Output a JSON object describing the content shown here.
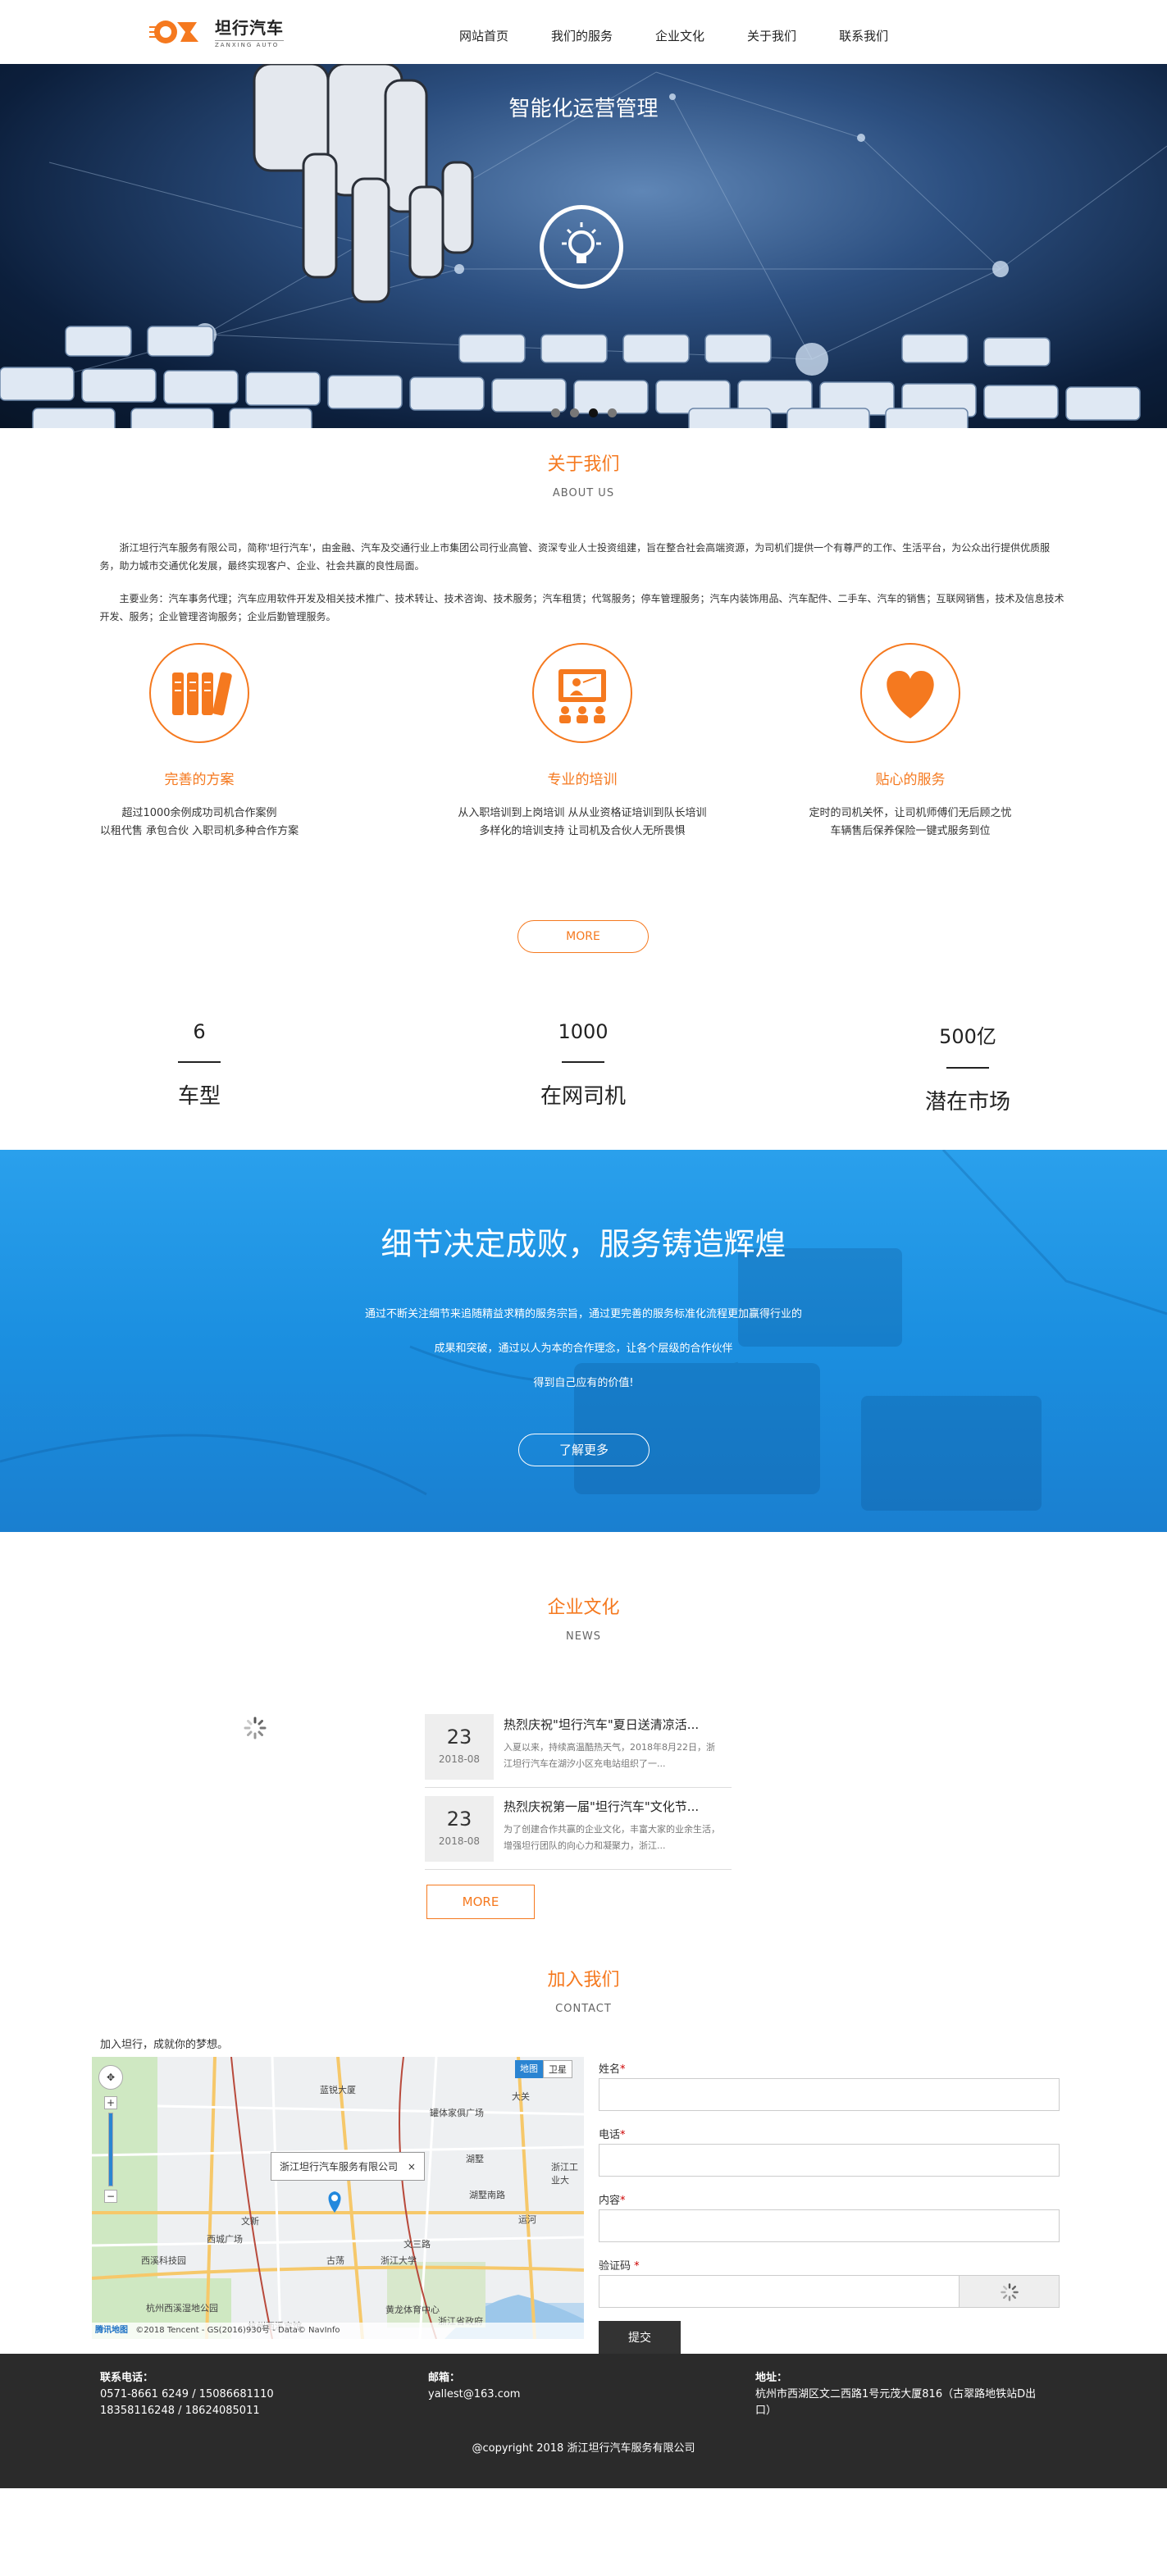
{
  "header": {
    "logo_cn": "坦行汽车",
    "logo_en": "ZANXING AUTO",
    "nav": [
      "网站首页",
      "我们的服务",
      "企业文化",
      "关于我们",
      "联系我们"
    ]
  },
  "hero": {
    "title": "智能化运营管理",
    "slide_count": 4,
    "active_slide": 3
  },
  "about": {
    "title": "关于我们",
    "subtitle": "ABOUT US",
    "para1": "浙江坦行汽车服务有限公司，简称'坦行汽车'，由金融、汽车及交通行业上市集团公司行业高管、资深专业人士投资组建，旨在整合社会高端资源，为司机们提供一个有尊严的工作、生活平台，为公众出行提供优质服务，助力城市交通优化发展，最终实现客户、企业、社会共赢的良性局面。",
    "para2": "主要业务：汽车事务代理；汽车应用软件开发及相关技术推广、技术转让、技术咨询、技术服务；汽车租赁；代驾服务；停车管理服务；汽车内装饰用品、汽车配件、二手车、汽车的销售；互联网销售，技术及信息技术开发、服务；企业管理咨询服务；企业后勤管理服务。",
    "features": [
      {
        "title": "完善的方案",
        "desc1": "超过1000余例成功司机合作案例",
        "desc2": "以租代售 承包合伙 入职司机多种合作方案",
        "icon": "books-icon"
      },
      {
        "title": "专业的培训",
        "desc1": "从入职培训到上岗培训 从从业资格证培训到队长培训",
        "desc2": "多样化的培训支持 让司机及合伙人无所畏惧",
        "icon": "teacher-icon"
      },
      {
        "title": "贴心的服务",
        "desc1": "定时的司机关怀，让司机师傅们无后顾之忧",
        "desc2": "车辆售后保养保险一键式服务到位",
        "icon": "heart-icon"
      }
    ],
    "more": "MORE"
  },
  "stats": [
    {
      "num": "6",
      "label": "车型"
    },
    {
      "num": "1000",
      "label": "在网司机"
    },
    {
      "num": "500亿",
      "label": "潜在市场"
    }
  ],
  "banner": {
    "title": "细节决定成败，服务铸造辉煌",
    "line1": "通过不断关注细节来追随精益求精的服务宗旨，通过更完善的服务标准化流程更加赢得行业的",
    "line2": "成果和突破，通过以人为本的合作理念，让各个层级的合作伙伴",
    "line3": "得到自己应有的价值!",
    "button": "了解更多"
  },
  "news": {
    "title": "企业文化",
    "subtitle": "NEWS",
    "items": [
      {
        "day": "23",
        "ym": "2018-08",
        "title": "热烈庆祝\"坦行汽车\"夏日送清凉活...",
        "summary": "入夏以来，持续高温酷热天气，2018年8月22日，浙江坦行汽车在湖汐小区充电站组织了一..."
      },
      {
        "day": "23",
        "ym": "2018-08",
        "title": "热烈庆祝第一届\"坦行汽车\"文化节...",
        "summary": "为了创建合作共赢的企业文化，丰富大家的业余生活，增强坦行团队的向心力和凝聚力，浙江..."
      }
    ],
    "more": "MORE"
  },
  "contact": {
    "title": "加入我们",
    "subtitle": "CONTACT",
    "intro": "加入坦行，成就你的梦想。",
    "map": {
      "toggle_map": "地图",
      "toggle_sat": "卫星",
      "popup": "浙江坦行汽车服务有限公司",
      "labels": [
        "蓝锐大厦",
        "大关",
        "罐体家俱广场",
        "湖墅",
        "浙江工业大",
        "湖墅南路",
        "文新",
        "西城广场",
        "古荡",
        "文三路",
        "杭州西溪湿地公园",
        "浙江大学",
        "杭州西溪宾馆",
        "黄龙体育中心",
        "浙江省政府",
        "运河",
        "西溪科技园"
      ],
      "brand": "腾讯地图",
      "copyright": "©2018 Tencent - GS(2016)930号 - Data© NavInfo"
    },
    "form": {
      "name_label": "姓名",
      "phone_label": "电话",
      "content_label": "内容",
      "captcha_label": "验证码",
      "submit": "提交"
    }
  },
  "footer": {
    "phone_label": "联系电话：",
    "phone1": "0571-8661 6249  /  15086681110",
    "phone2": "18358116248  /  18624085011",
    "email_label": "邮箱：",
    "email": "yallest@163.com",
    "addr_label": "地址：",
    "addr1": "杭州市西湖区文二西路1号元茂大厦816（古翠路地铁站D出",
    "addr2": "口）",
    "copyright": "@copyright 2018 浙江坦行汽车服务有限公司"
  },
  "colors": {
    "accent": "#f5791f",
    "banner": "#1b8fe0",
    "footer": "#2b2b2b"
  }
}
